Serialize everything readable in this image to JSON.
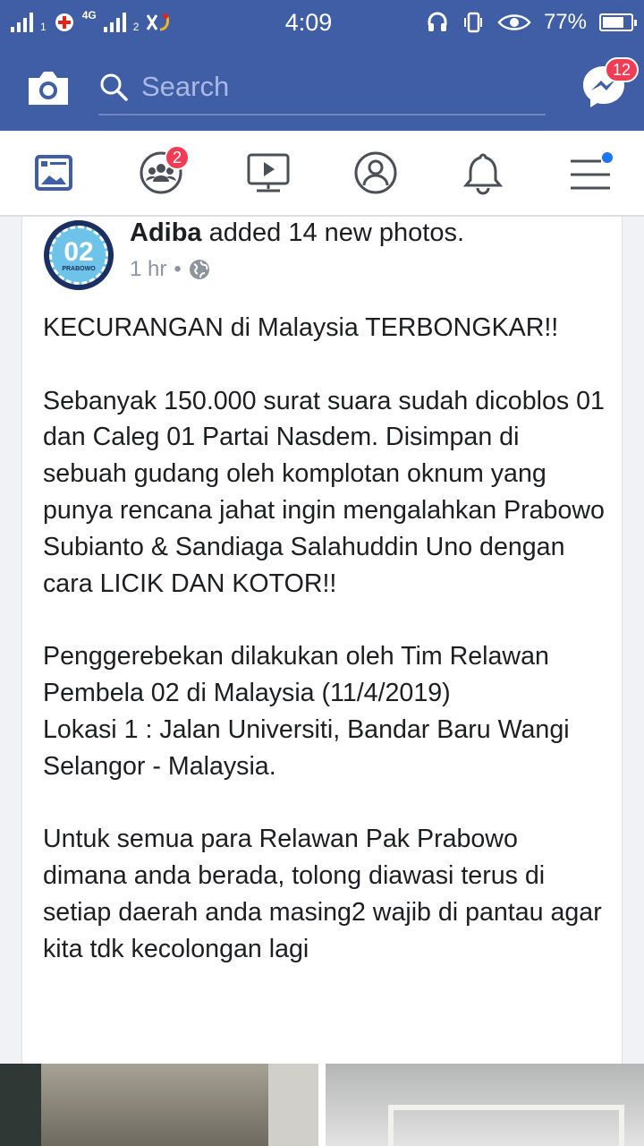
{
  "status_bar": {
    "sim1": "1",
    "sim2": "2",
    "network": "4G",
    "time": "4:09",
    "battery": "77%",
    "battery_level": 0.77
  },
  "app_bar": {
    "search_placeholder": "Search",
    "messenger_badge": "12"
  },
  "nav": {
    "friends_badge": "2",
    "tabs": [
      "news-feed",
      "groups",
      "watch",
      "profile",
      "notifications",
      "menu"
    ]
  },
  "post": {
    "avatar_text": "02",
    "avatar_subtext": "PRABOWO",
    "author": "Adiba",
    "action": " added 14 new photos.",
    "time": "1 hr",
    "separator": "•",
    "body": "KECURANGAN di Malaysia TERBONGKAR!!\n\nSebanyak 150.000 surat suara sudah dicoblos 01 dan Caleg 01 Partai Nasdem. Disimpan di sebuah gudang oleh komplotan oknum yang punya rencana jahat ingin mengalahkan Prabowo Subianto & Sandiaga Salahuddin Uno dengan cara LICIK DAN KOTOR!!\n\nPenggerebekan dilakukan oleh Tim Relawan Pembela 02 di Malaysia (11/4/2019)\nLokasi 1 : Jalan Universiti, Bandar Baru Wangi Selangor - Malaysia.\n\nUntuk semua para Relawan Pak Prabowo dimana anda berada, tolong diawasi terus di setiap daerah anda masing2 wajib di pantau agar kita tdk kecolongan lagi"
  },
  "colors": {
    "brand": "#3f5ea6",
    "badge": "#f03c54",
    "icon": "#4b4f56",
    "dot": "#1877f2"
  }
}
